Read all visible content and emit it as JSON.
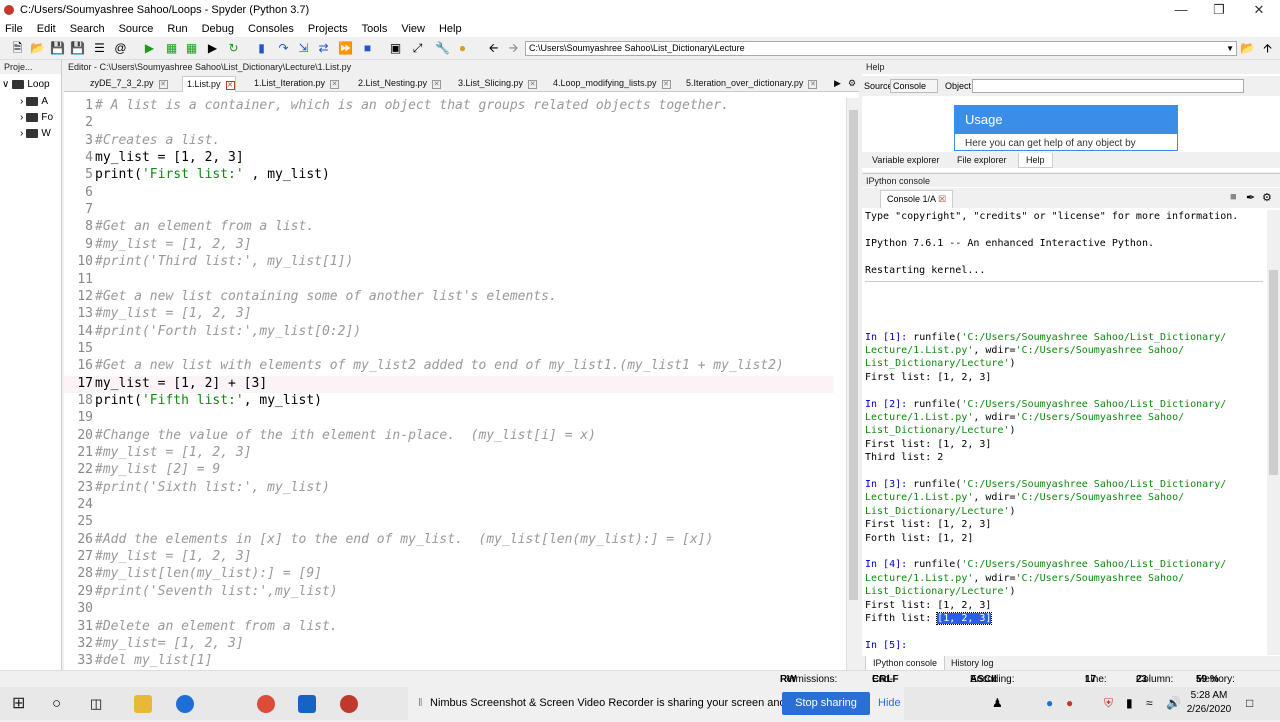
{
  "window": {
    "title": "C:/Users/Soumyashree Sahoo/Loops - Spyder (Python 3.7)"
  },
  "menu": [
    "File",
    "Edit",
    "Search",
    "Source",
    "Run",
    "Debug",
    "Consoles",
    "Projects",
    "Tools",
    "View",
    "Help"
  ],
  "toolbar": {
    "path": "C:\\Users\\Soumyashree Sahoo\\List_Dictionary\\Lecture"
  },
  "project": {
    "header": "Proje...",
    "root": "Loop",
    "items": [
      "A",
      "Fo",
      "W"
    ]
  },
  "editor": {
    "header": "Editor - C:\\Users\\Soumyashree Sahoo\\List_Dictionary\\Lecture\\1.List.py",
    "tabs": [
      "zyDE_7_3_2.py",
      "1.List.py",
      "1.List_Iteration.py",
      "2.List_Nesting.py",
      "3.List_Slicing.py",
      "4.Loop_modifying_lists.py",
      "5.Iteration_over_dictionary.py"
    ],
    "lines": [
      {
        "n": "1",
        "t": "# A list is a container, which is an object that groups related objects together.",
        "k": "c"
      },
      {
        "n": "2",
        "t": "",
        "k": "n"
      },
      {
        "n": "3",
        "t": "#Creates a list.",
        "k": "c"
      },
      {
        "n": "4",
        "t": "my_list = [1, 2, 3]",
        "k": "n"
      },
      {
        "n": "5",
        "t": "print('First list:' , my_list)",
        "k": "n"
      },
      {
        "n": "6",
        "t": "",
        "k": "n"
      },
      {
        "n": "7",
        "t": "",
        "k": "n"
      },
      {
        "n": "8",
        "t": "#Get an element from a list.",
        "k": "c"
      },
      {
        "n": "9",
        "t": "#my_list = [1, 2, 3]",
        "k": "c"
      },
      {
        "n": "10",
        "t": "#print('Third list:', my_list[1])",
        "k": "c"
      },
      {
        "n": "11",
        "t": "",
        "k": "n"
      },
      {
        "n": "12",
        "t": "#Get a new list containing some of another list's elements.",
        "k": "c"
      },
      {
        "n": "13",
        "t": "#my_list = [1, 2, 3]",
        "k": "c"
      },
      {
        "n": "14",
        "t": "#print('Forth list:',my_list[0:2])",
        "k": "c"
      },
      {
        "n": "15",
        "t": "",
        "k": "n"
      },
      {
        "n": "16",
        "t": "#Get a new list with elements of my_list2 added to end of my_list1.(my_list1 + my_list2)",
        "k": "c"
      },
      {
        "n": "17",
        "t": "my_list = [1, 2] + [3]",
        "k": "n"
      },
      {
        "n": "18",
        "t": "print('Fifth list:', my_list)",
        "k": "n"
      },
      {
        "n": "19",
        "t": "",
        "k": "n"
      },
      {
        "n": "20",
        "t": "#Change the value of the ith element in-place.  (my_list[i] = x)",
        "k": "c"
      },
      {
        "n": "21",
        "t": "#my_list = [1, 2, 3]",
        "k": "c"
      },
      {
        "n": "22",
        "t": "#my_list [2] = 9",
        "k": "c"
      },
      {
        "n": "23",
        "t": "#print('Sixth list:', my_list)",
        "k": "c"
      },
      {
        "n": "24",
        "t": "",
        "k": "n"
      },
      {
        "n": "25",
        "t": "",
        "k": "n"
      },
      {
        "n": "26",
        "t": "#Add the elements in [x] to the end of my_list.  (my_list[len(my_list):] = [x])",
        "k": "c"
      },
      {
        "n": "27",
        "t": "#my_list = [1, 2, 3]",
        "k": "c"
      },
      {
        "n": "28",
        "t": "#my_list[len(my_list):] = [9]",
        "k": "c"
      },
      {
        "n": "29",
        "t": "#print('Seventh list:',my_list)",
        "k": "c"
      },
      {
        "n": "30",
        "t": "",
        "k": "n"
      },
      {
        "n": "31",
        "t": "#Delete an element from a list.",
        "k": "c"
      },
      {
        "n": "32",
        "t": "#my_list= [1, 2, 3]",
        "k": "c"
      },
      {
        "n": "33",
        "t": "#del my_list[1]",
        "k": "c"
      }
    ]
  },
  "help": {
    "header": "Help",
    "source_label": "Source",
    "source_value": "Console",
    "object_label": "Object",
    "usage_title": "Usage",
    "usage_text": "Here you can get help of any object by",
    "tabs": [
      "Variable explorer",
      "File explorer",
      "Help"
    ]
  },
  "console": {
    "header": "IPython console",
    "tab": "Console 1/A",
    "bottom_tabs": [
      "IPython console",
      "History log"
    ],
    "lines": [
      [
        "Type \"copyright\", \"credits\" or \"license\" for more information."
      ],
      [
        ""
      ],
      [
        "IPython 7.6.1 -- An enhanced Interactive Python."
      ],
      [
        ""
      ],
      [
        "Restarting kernel..."
      ],
      [
        ""
      ],
      [
        ""
      ],
      [
        ""
      ],
      [
        ""
      ],
      [
        "In [1]: runfile('C:/Users/Soumyashree Sahoo/List_Dictionary/"
      ],
      [
        "Lecture/1.List.py', wdir='C:/Users/Soumyashree Sahoo/"
      ],
      [
        "List_Dictionary/Lecture')"
      ],
      [
        "First list: [1, 2, 3]"
      ],
      [
        ""
      ],
      [
        "In [2]: runfile('C:/Users/Soumyashree Sahoo/List_Dictionary/"
      ],
      [
        "Lecture/1.List.py', wdir='C:/Users/Soumyashree Sahoo/"
      ],
      [
        "List_Dictionary/Lecture')"
      ],
      [
        "First list: [1, 2, 3]"
      ],
      [
        "Third list: 2"
      ],
      [
        ""
      ],
      [
        "In [3]: runfile('C:/Users/Soumyashree Sahoo/List_Dictionary/"
      ],
      [
        "Lecture/1.List.py', wdir='C:/Users/Soumyashree Sahoo/"
      ],
      [
        "List_Dictionary/Lecture')"
      ],
      [
        "First list: [1, 2, 3]"
      ],
      [
        "Forth list: [1, 2]"
      ],
      [
        ""
      ],
      [
        "In [4]: runfile('C:/Users/Soumyashree Sahoo/List_Dictionary/"
      ],
      [
        "Lecture/1.List.py', wdir='C:/Users/Soumyashree Sahoo/"
      ],
      [
        "List_Dictionary/Lecture')"
      ],
      [
        "First list: [1, 2, 3]"
      ],
      [
        "Fifth list: ",
        "[1, 2, 3]"
      ],
      [
        ""
      ],
      [
        "In [5]: "
      ]
    ]
  },
  "status": {
    "permissions_label": "Permissions:",
    "permissions": "RW",
    "eol_label": "End-of-lines:",
    "eol": "CRLF",
    "encoding_label": "Encoding:",
    "encoding": "ASCII",
    "line_label": "Line:",
    "line": "17",
    "column_label": "Column:",
    "column": "23",
    "memory_label": "Memory:",
    "memory": "59 %"
  },
  "taskbar": {
    "share_text": "Nimbus Screenshot & Screen Video Recorder is sharing your screen and audio.",
    "stop_label": "Stop sharing",
    "hide_label": "Hide",
    "time": "5:28 AM",
    "date": "2/26/2020"
  }
}
